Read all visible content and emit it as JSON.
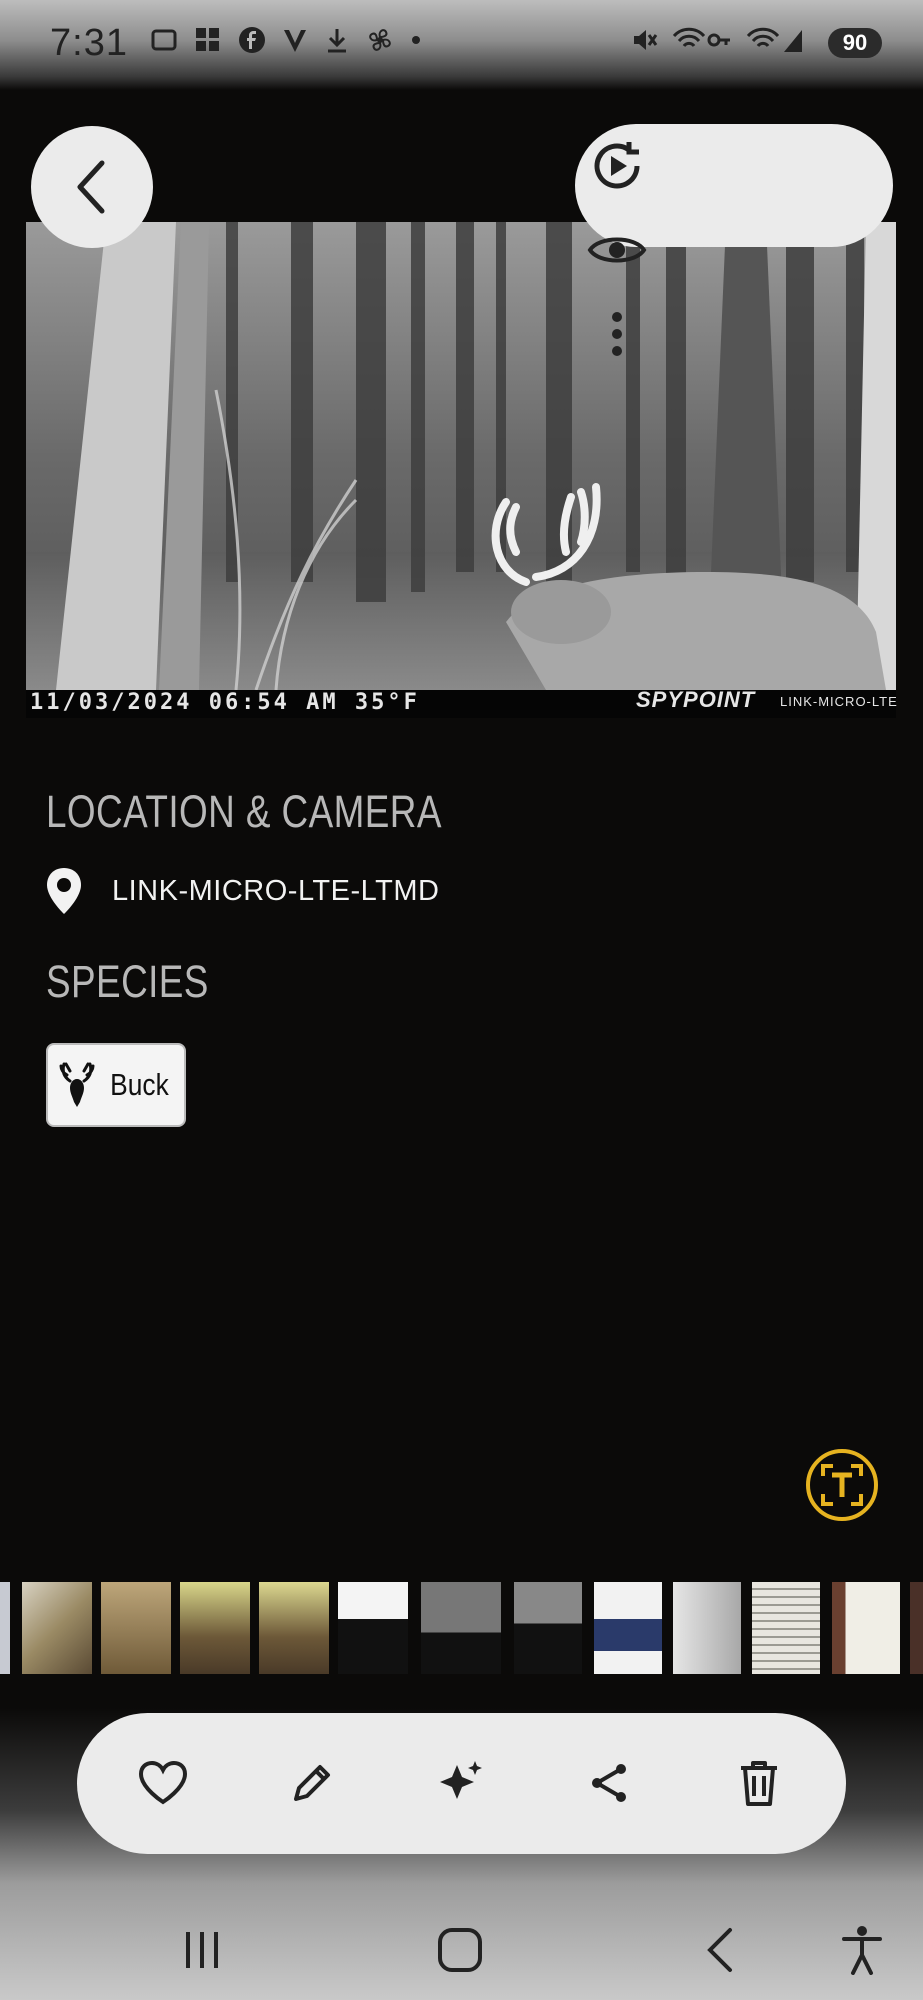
{
  "status_bar": {
    "time": "7:31",
    "battery": "90"
  },
  "photo": {
    "stamp_date": "11/03/2024  06:54 AM   35°F",
    "brand": "SPYPOINT",
    "model": "LINK-MICRO-LTE"
  },
  "info": {
    "location_heading": "LOCATION & CAMERA",
    "location_value": "LINK-MICRO-LTE-LTMD",
    "species_heading": "SPECIES",
    "species_chip": "Buck"
  },
  "toolbar_top": {
    "icons": [
      "back-icon",
      "motion-photo-icon",
      "eye-icon",
      "more-options-icon"
    ]
  },
  "toolbar_bottom": {
    "icons": [
      "heart-icon",
      "edit-icon",
      "ai-sparkle-icon",
      "share-icon",
      "delete-icon"
    ]
  },
  "colors": {
    "background": "#0b0a09",
    "pill": "#ebebeb",
    "text_scan_accent": "#e6b320",
    "heading": "#b8b8b8"
  }
}
